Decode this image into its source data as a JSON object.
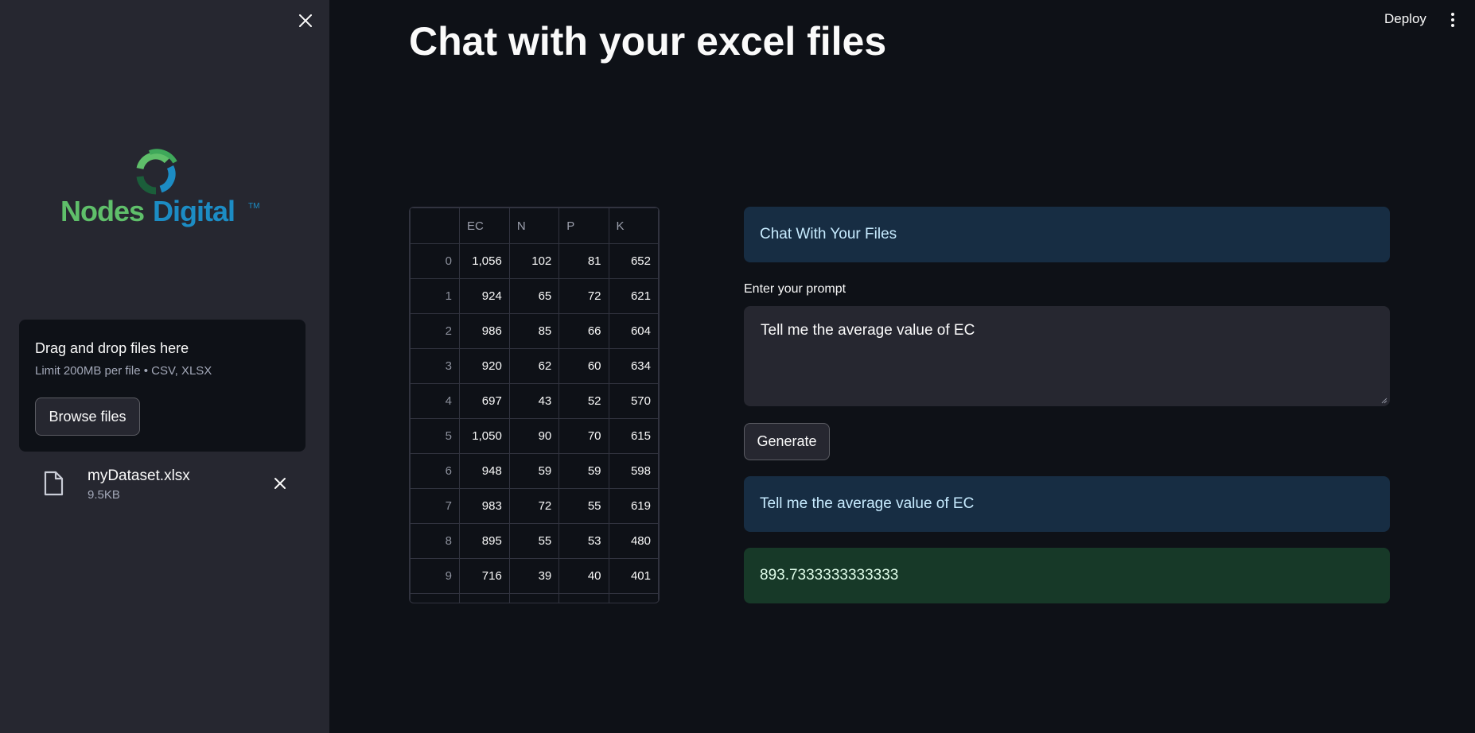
{
  "sidebar": {
    "logo": {
      "name": "Nodes Digital",
      "word1": "Nodes",
      "word2": "Digital",
      "tm": "TM",
      "color_green": "#5fbf6a",
      "color_blue": "#1c8cc4"
    },
    "uploader": {
      "title": "Drag and drop files here",
      "subtitle": "Limit 200MB per file • CSV, XLSX",
      "browse_label": "Browse files"
    },
    "file": {
      "name": "myDataset.xlsx",
      "size": "9.5KB",
      "icon": "file-icon"
    }
  },
  "header": {
    "deploy_label": "Deploy"
  },
  "main": {
    "title": "Chat with your excel files",
    "table": {
      "columns": [
        "",
        "EC",
        "N",
        "P",
        "K"
      ],
      "rows": [
        [
          "0",
          "1,056",
          "102",
          "81",
          "652"
        ],
        [
          "1",
          "924",
          "65",
          "72",
          "621"
        ],
        [
          "2",
          "986",
          "85",
          "66",
          "604"
        ],
        [
          "3",
          "920",
          "62",
          "60",
          "634"
        ],
        [
          "4",
          "697",
          "43",
          "52",
          "570"
        ],
        [
          "5",
          "1,050",
          "90",
          "70",
          "615"
        ],
        [
          "6",
          "948",
          "59",
          "59",
          "598"
        ],
        [
          "7",
          "983",
          "72",
          "55",
          "619"
        ],
        [
          "8",
          "895",
          "55",
          "53",
          "480"
        ],
        [
          "9",
          "716",
          "39",
          "40",
          "401"
        ]
      ]
    },
    "chat_header": "Chat With Your Files",
    "prompt_label": "Enter your prompt",
    "prompt_value": "Tell me the average value of EC",
    "generate_label": "Generate",
    "echo": "Tell me the average value of EC",
    "result": "893.7333333333333"
  },
  "colors": {
    "background": "#0e1117",
    "sidebar": "#262730",
    "info_blue": "#172d43",
    "success_green": "#173928"
  }
}
